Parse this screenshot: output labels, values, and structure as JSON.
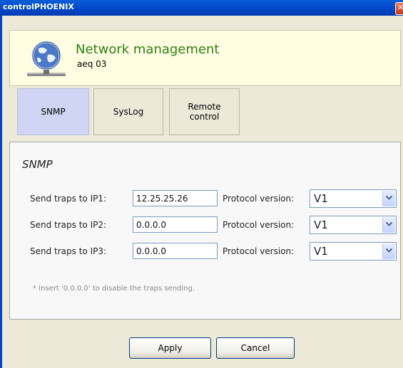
{
  "window": {
    "title": "controlPHOENIX"
  },
  "header": {
    "title": "Network management",
    "subtitle": "aeq 03"
  },
  "tabs": [
    {
      "label": "SNMP",
      "active": true
    },
    {
      "label": "SysLog",
      "active": false
    },
    {
      "label": "Remote control",
      "active": false
    }
  ],
  "snmp": {
    "section_title": "SNMP",
    "rows": [
      {
        "label": "Send traps to IP1:",
        "ip": "12.25.25.26",
        "protocol_label": "Protocol version:",
        "protocol": "V1"
      },
      {
        "label": "Send traps to IP2:",
        "ip": "0.0.0.0",
        "protocol_label": "Protocol version:",
        "protocol": "V1"
      },
      {
        "label": "Send traps to IP3:",
        "ip": "0.0.0.0",
        "protocol_label": "Protocol version:",
        "protocol": "V1"
      }
    ],
    "note": "* Insert '0.0.0.0' to disable the traps sending."
  },
  "buttons": {
    "apply": "Apply",
    "cancel": "Cancel"
  },
  "colors": {
    "titlebar": "#0047c9",
    "header_bg": "#fffee2",
    "header_title": "#2d7f18",
    "active_tab": "#cfd5f3"
  }
}
